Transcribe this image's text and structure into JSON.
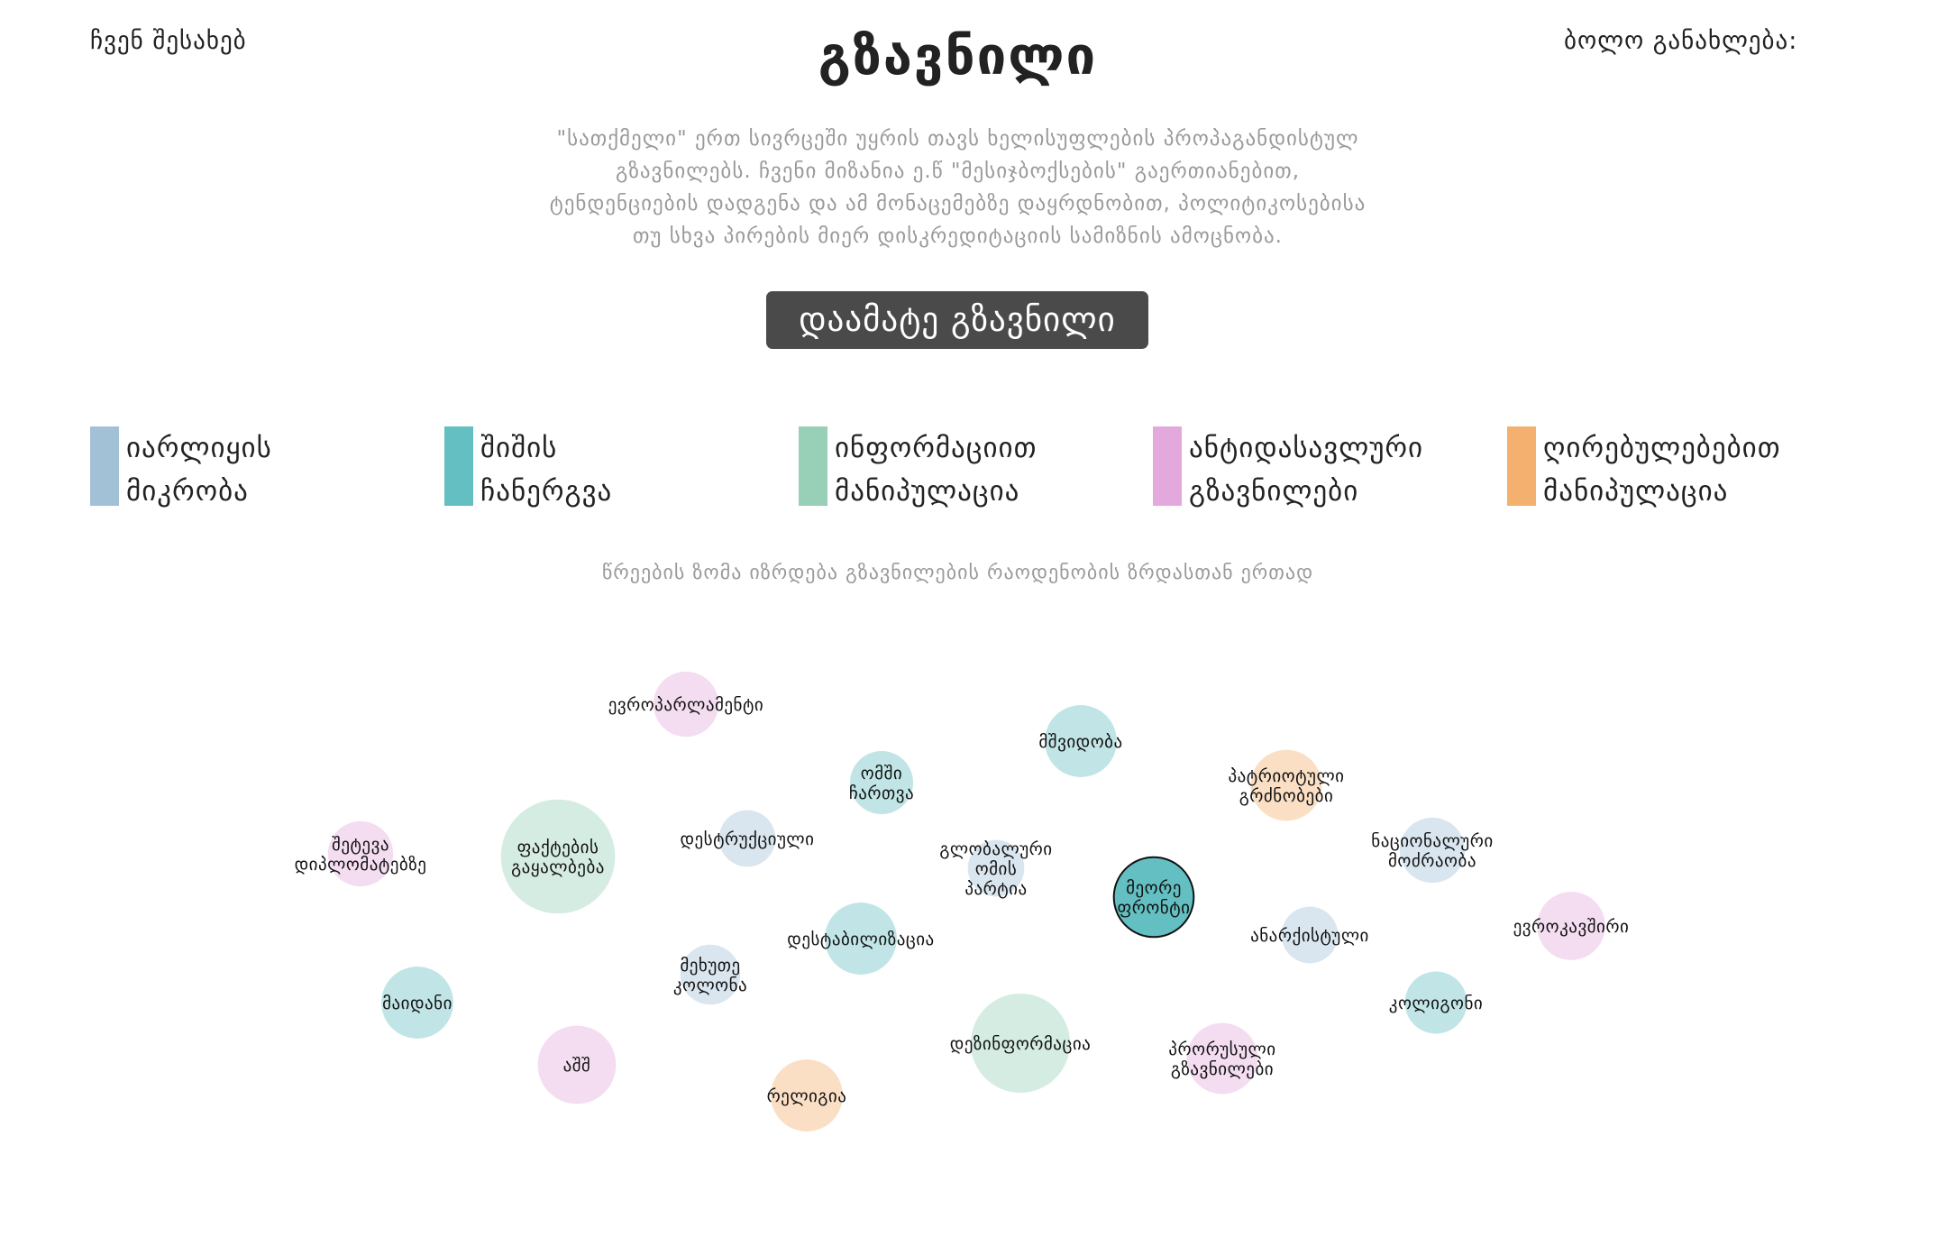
{
  "header": {
    "about_label": "ჩვენ შესახებ",
    "title": "გზავნილი",
    "last_update_label": "ბოლო განახლება:"
  },
  "intro": {
    "lines": [
      "\"სათქმელი\" ერთ სივრცეში უყრის თავს ხელისუფლების პროპაგანდისტულ",
      "გზავნილებს. ჩვენი მიზანია ე.წ \"მესიჯბოქსების\" გაერთიანებით,",
      "ტენდენციების დადგენა და ამ მონაცემებზე დაყრდნობით, პოლიტიკოსებისა",
      "თუ სხვა პირების მიერ დისკრედიტაციის სამიზნის ამოცნობა."
    ]
  },
  "add_button_label": "დაამატე გზავნილი",
  "legend": [
    {
      "label": "იარლიყის\nმიკრობა",
      "color": "#a3c1d6"
    },
    {
      "label": "შიშის\nჩანერგვა",
      "color": "#63bfc1"
    },
    {
      "label": "ინფორმაციით\nმანიპულაცია",
      "color": "#97cfb7"
    },
    {
      "label": "ანტიდასავლური\nგზავნილები",
      "color": "#e3a9dc"
    },
    {
      "label": "ღირებულებებით\nმანიპულაცია",
      "color": "#f3b06e"
    }
  ],
  "size_note": "წრეების ზომა იზრდება გზავნილების რაოდენობის ზრდასთან ერთად",
  "bubbles": [
    {
      "label": [
        "ევროპარლამენტი"
      ],
      "category": 3,
      "size": 1.6
    },
    {
      "label": [
        "ომში",
        "ჩართვა"
      ],
      "category": 1,
      "size": 1.5
    },
    {
      "label": [
        "მშვიდობა"
      ],
      "category": 1,
      "size": 1.95
    },
    {
      "label": [
        "პატრიოტული",
        "გრძნობები"
      ],
      "category": 4,
      "size": 1.9
    },
    {
      "label": [
        "შეტევა",
        "დიპლომატებზე"
      ],
      "category": 3,
      "size": 1.6
    },
    {
      "label": [
        "ფაქტების",
        "გაყალბება"
      ],
      "category": 2,
      "size": 4.9
    },
    {
      "label": [
        "დესტრუქციული"
      ],
      "category": 0,
      "size": 1.2
    },
    {
      "label": [
        "გლობალური",
        "ომის",
        "პარტია"
      ],
      "category": 0,
      "size": 1.2
    },
    {
      "label": [
        "მეორე",
        "ფრონტი"
      ],
      "category": 1,
      "size": 2.4
    },
    {
      "label": [
        "ნაციონალური",
        "მოძრაობა"
      ],
      "category": 0,
      "size": 1.6
    },
    {
      "label": [
        "ევროკავშირი"
      ],
      "category": 3,
      "size": 1.75
    },
    {
      "label": [
        "დესტაბილიზაცია"
      ],
      "category": 1,
      "size": 1.95
    },
    {
      "label": [
        "მეხუთე",
        "კოლონა"
      ],
      "category": 0,
      "size": 1.35
    },
    {
      "label": [
        "ანარქისტული"
      ],
      "category": 0,
      "size": 1.2
    },
    {
      "label": [
        "მაიდანი"
      ],
      "category": 1,
      "size": 1.95
    },
    {
      "label": [
        "კოლიგონი"
      ],
      "category": 1,
      "size": 1.45
    },
    {
      "label": [
        "დეზინფორმაცია"
      ],
      "category": 2,
      "size": 3.7
    },
    {
      "label": [
        "პრორუსული",
        "გზავნილები"
      ],
      "category": 3,
      "size": 1.9
    },
    {
      "label": [
        "აშშ"
      ],
      "category": 3,
      "size": 2.3
    },
    {
      "label": [
        "რელიგია"
      ],
      "category": 4,
      "size": 1.95
    }
  ]
}
